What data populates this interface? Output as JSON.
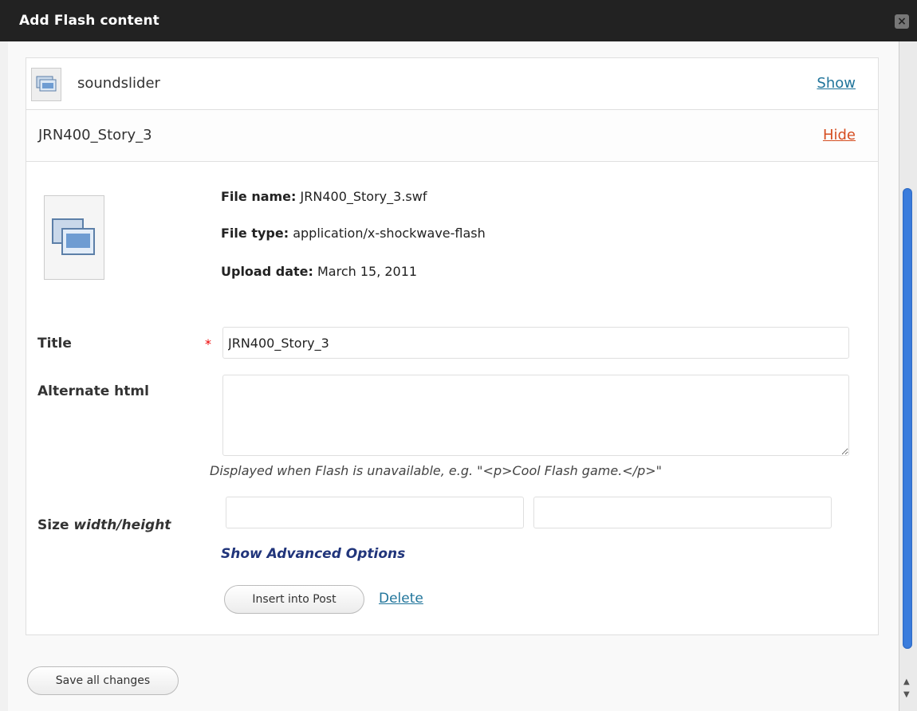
{
  "dialog": {
    "title": "Add Flash content",
    "close_label": "×"
  },
  "items": [
    {
      "name": "soundslider",
      "toggle": "Show"
    },
    {
      "name": "JRN400_Story_3",
      "toggle": "Hide"
    }
  ],
  "details": {
    "file_name_label": "File name:",
    "file_name": "JRN400_Story_3.swf",
    "file_type_label": "File type:",
    "file_type": "application/x-shockwave-flash",
    "upload_date_label": "Upload date:",
    "upload_date": "March 15, 2011"
  },
  "form": {
    "title_label": "Title",
    "required_mark": "*",
    "title_value": "JRN400_Story_3",
    "alt_label": "Alternate html",
    "alt_value": "",
    "alt_help": "Displayed when Flash is unavailable, e.g. \"<p>Cool Flash game.</p>\"",
    "size_label": "Size",
    "size_hint": "width/height",
    "width_value": "",
    "height_value": "",
    "advanced_link": "Show Advanced Options",
    "insert_button": "Insert into Post",
    "delete_link": "Delete"
  },
  "footer": {
    "save_button": "Save all changes"
  },
  "colors": {
    "link": "#21759b",
    "hide_link": "#d54e21",
    "titlebar": "#222222",
    "scroll_thumb": "#3b7ddd"
  }
}
